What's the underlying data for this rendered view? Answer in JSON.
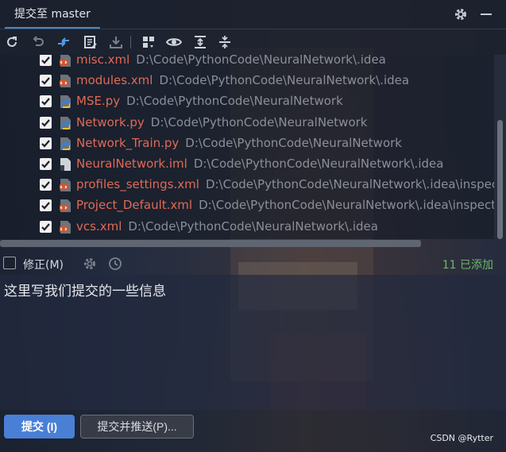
{
  "window": {
    "tab_title": "提交至 master",
    "icons": [
      "settings-gear-icon",
      "minimize-icon"
    ]
  },
  "toolbar": {
    "icons": [
      "refresh-icon",
      "rollback-icon",
      "show-diff-icon",
      "edit-source-icon",
      "shelve-icon",
      "group-by-icon",
      "preview-eye-icon",
      "expand-all-icon",
      "collapse-all-icon"
    ]
  },
  "files": [
    {
      "name": "misc.xml",
      "path": "D:\\Code\\PythonCode\\NeuralNetwork\\.idea",
      "type": "xml"
    },
    {
      "name": "modules.xml",
      "path": "D:\\Code\\PythonCode\\NeuralNetwork\\.idea",
      "type": "xml"
    },
    {
      "name": "MSE.py",
      "path": "D:\\Code\\PythonCode\\NeuralNetwork",
      "type": "py"
    },
    {
      "name": "Network.py",
      "path": "D:\\Code\\PythonCode\\NeuralNetwork",
      "type": "py"
    },
    {
      "name": "Network_Train.py",
      "path": "D:\\Code\\PythonCode\\NeuralNetwork",
      "type": "py"
    },
    {
      "name": "NeuralNetwork.iml",
      "path": "D:\\Code\\PythonCode\\NeuralNetwork\\.idea",
      "type": "iml"
    },
    {
      "name": "profiles_settings.xml",
      "path": "D:\\Code\\PythonCode\\NeuralNetwork\\.idea\\inspecti",
      "type": "xml"
    },
    {
      "name": "Project_Default.xml",
      "path": "D:\\Code\\PythonCode\\NeuralNetwork\\.idea\\inspectio",
      "type": "xml"
    },
    {
      "name": "vcs.xml",
      "path": "D:\\Code\\PythonCode\\NeuralNetwork\\.idea",
      "type": "xml"
    }
  ],
  "amend": {
    "label": "修正(M)",
    "added_count": "11 已添加"
  },
  "message": {
    "text": "这里写我们提交的一些信息"
  },
  "actions": {
    "commit_label": "提交 (I)",
    "commit_push_label": "提交并推送(P)..."
  },
  "watermark": "CSDN @Rytter",
  "colors": {
    "accent": "#4a7fd6",
    "file_name": "#e06a55",
    "added": "#6fb86a"
  }
}
